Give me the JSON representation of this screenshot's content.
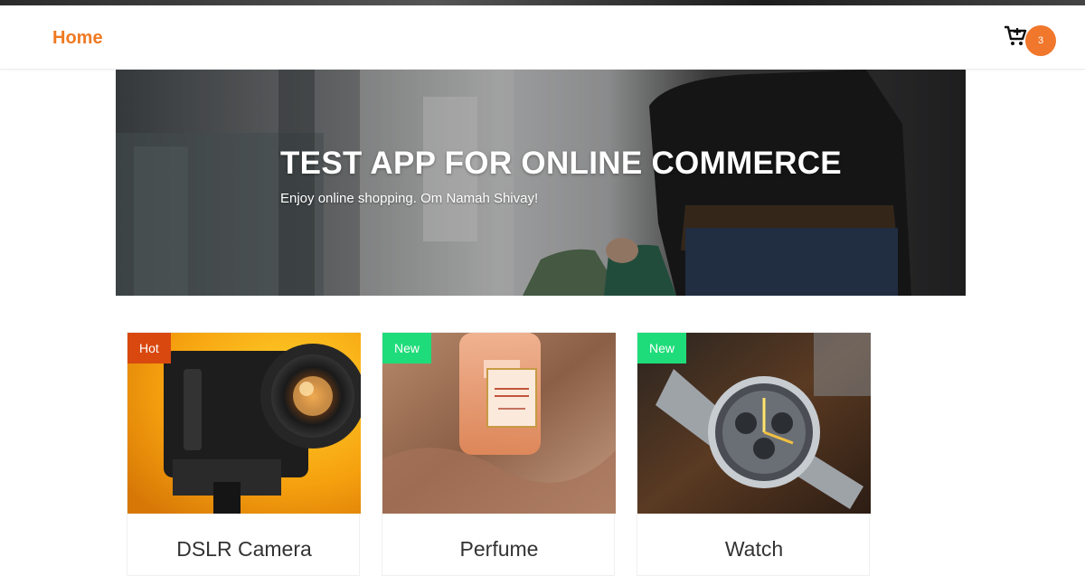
{
  "nav": {
    "home_label": "Home",
    "cart_icon": "cart-plus-icon",
    "cart_count": "3",
    "accent_color": "#ef7a23",
    "badge_color": "#f0772b"
  },
  "hero": {
    "title": "TEST APP FOR ONLINE COMMERCE",
    "subtitle": "Enjoy online shopping. Om Namah Shivay!"
  },
  "products": [
    {
      "name": "DSLR Camera",
      "badge": "Hot",
      "badge_color": "#d9480f"
    },
    {
      "name": "Perfume",
      "badge": "New",
      "badge_color": "#1fdc7a"
    },
    {
      "name": "Watch",
      "badge": "New",
      "badge_color": "#1fdc7a"
    }
  ]
}
